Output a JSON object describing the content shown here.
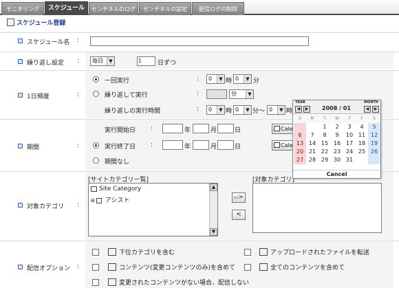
{
  "tabs": [
    {
      "label": "モニタリング",
      "active": false
    },
    {
      "label": "スケジュール",
      "active": true
    },
    {
      "label": "センチネルのログ",
      "active": false
    },
    {
      "label": "センチネルの設定",
      "active": false
    },
    {
      "label": "配信ログの削除",
      "active": false
    }
  ],
  "section_title": "スケジュール登録",
  "colon": ":",
  "schedule_name": {
    "label": "スケジュール名",
    "value": ""
  },
  "repeat": {
    "label": "繰り返し設定",
    "select_value": "毎日",
    "count_value": "1",
    "unit": "日ずつ"
  },
  "frequency": {
    "label": "1日頻度",
    "once_label": "一回実行",
    "repeat_label": "繰り返して実行",
    "repeat_time_label": "繰り返しの実行時間",
    "hour": "0",
    "minute": "0",
    "hour_unit": "時",
    "minute_unit": "分",
    "repeat_interval_unit": "分",
    "range_sep": "～",
    "hour2_value": "0"
  },
  "period": {
    "label": "期間",
    "start_label": "実行開始日",
    "end_label": "実行終了日",
    "none_label": "期間なし",
    "year_unit": "年",
    "month_unit": "月",
    "day_unit": "日",
    "calendar_button": "Calendar"
  },
  "target": {
    "label": "対象カテゴリ",
    "site_tree_label": "[サイトカテゴリー覧]",
    "target_label": "[対象カテゴリ]",
    "tree_root": "Site Category",
    "tree_child": "アシスト",
    "add_symbol": ">",
    "remove_symbol": "<"
  },
  "delivery": {
    "label": "配信オプション",
    "options": [
      "下位カテゴリを含む",
      "アップロードされたファイルを転送",
      "コンテンツ(変更コンテンツのみ)を含めて",
      "全てのコンテンツを含めて",
      "変更されたコンテンツがない場合、配信しない"
    ]
  },
  "calendar": {
    "year_label": "YEAR",
    "month_label": "MONTH",
    "title": "2008 / 01",
    "weekdays": [
      "S",
      "M",
      "T",
      "W",
      "T",
      "F",
      "S"
    ],
    "weeks": [
      [
        "",
        "",
        "1",
        "2",
        "3",
        "4",
        "5"
      ],
      [
        "6",
        "7",
        "8",
        "9",
        "10",
        "11",
        "12"
      ],
      [
        "13",
        "14",
        "15",
        "16",
        "17",
        "18",
        "19"
      ],
      [
        "20",
        "21",
        "22",
        "23",
        "24",
        "25",
        "26"
      ],
      [
        "27",
        "28",
        "29",
        "30",
        "31",
        "",
        ""
      ]
    ],
    "cancel": "Cancel"
  }
}
